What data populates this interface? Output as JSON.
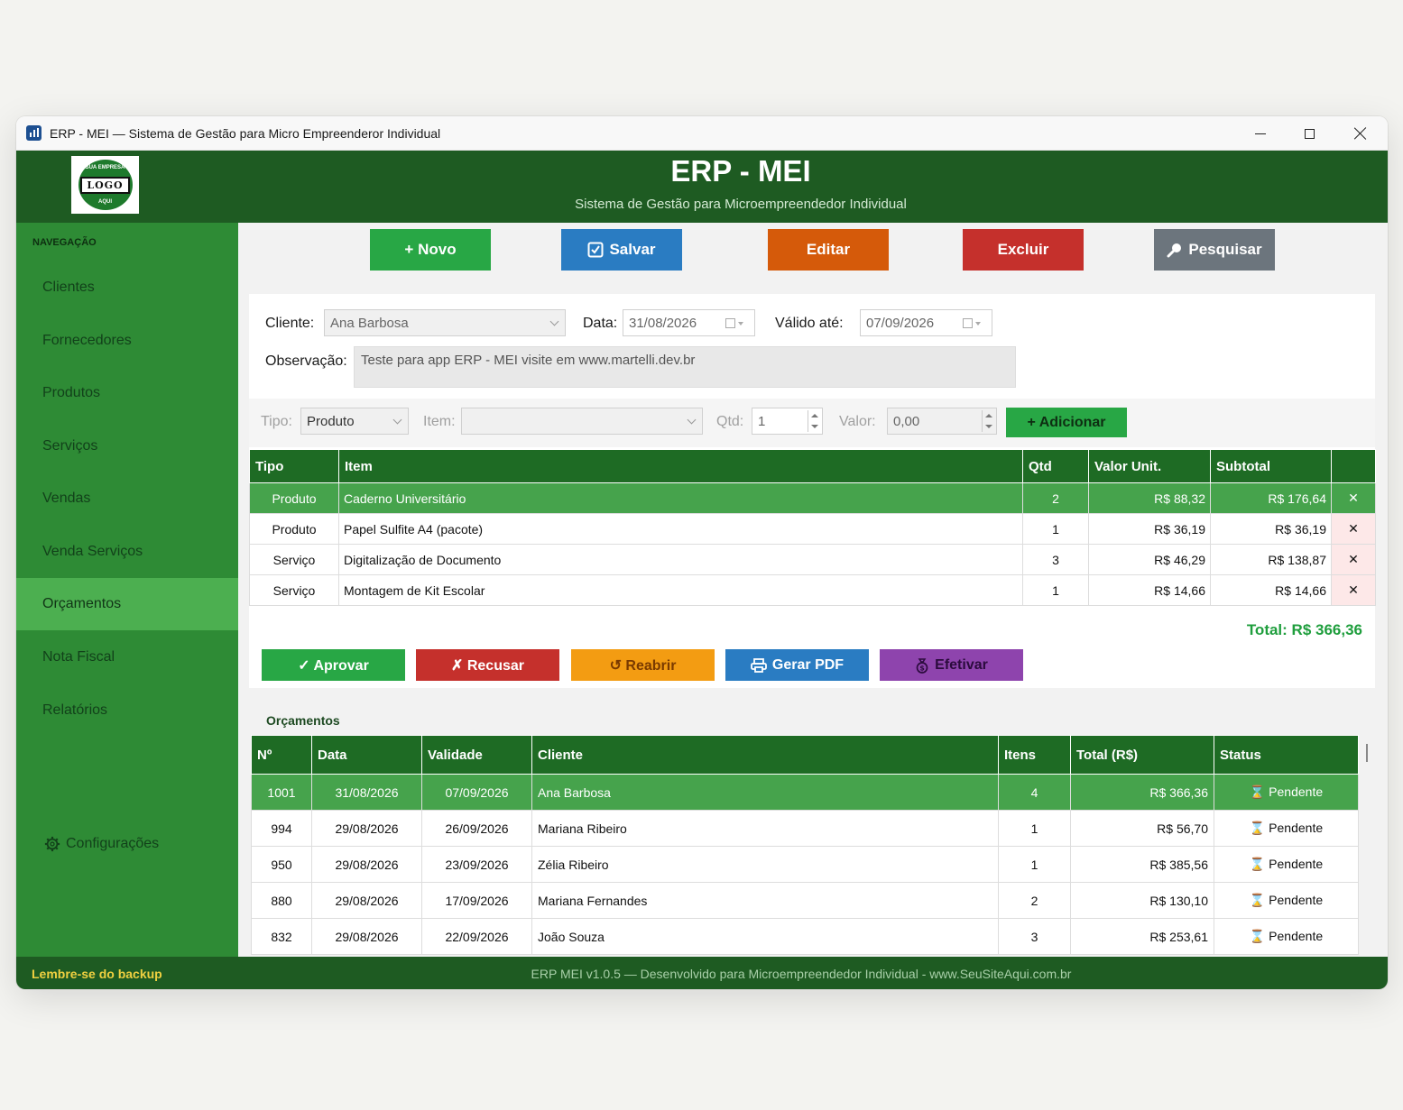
{
  "window": {
    "title": "ERP - MEI — Sistema de Gestão para Micro Empreenderor Individual"
  },
  "header": {
    "logo": {
      "top_text": "SUA EMPRESA",
      "main_text": "LOGO",
      "bottom_text": "AQUI"
    },
    "title": "ERP - MEI",
    "subtitle": "Sistema de Gestão para Microempreendedor Individual"
  },
  "sidebar": {
    "section_label": "NAVEGAÇÃO",
    "items": [
      {
        "label": "Clientes"
      },
      {
        "label": "Fornecedores"
      },
      {
        "label": "Produtos"
      },
      {
        "label": "Serviços"
      },
      {
        "label": "Vendas"
      },
      {
        "label": "Venda Serviços"
      },
      {
        "label": "Orçamentos",
        "active": true
      },
      {
        "label": "Nota Fiscal"
      },
      {
        "label": "Relatórios"
      }
    ],
    "settings_label": "Configurações"
  },
  "toolbar": {
    "novo": "+ Novo",
    "salvar": "Salvar",
    "editar": "Editar",
    "excluir": "Excluir",
    "pesquisar": "Pesquisar"
  },
  "form": {
    "cliente_label": "Cliente:",
    "cliente_value": "Ana Barbosa",
    "data_label": "Data:",
    "data_value": "31/08/2026",
    "valido_label": "Válido até:",
    "valido_value": "07/09/2026",
    "obs_label": "Observação:",
    "obs_value": "Teste para app ERP - MEI visite em www.martelli.dev.br"
  },
  "add_item": {
    "tipo_label": "Tipo:",
    "tipo_value": "Produto",
    "item_label": "Item:",
    "item_value": "",
    "qtd_label": "Qtd:",
    "qtd_value": "1",
    "valor_label": "Valor:",
    "valor_value": "0,00",
    "add_button": "+ Adicionar"
  },
  "items_table": {
    "headers": [
      "Tipo",
      "Item",
      "Qtd",
      "Valor Unit.",
      "Subtotal",
      ""
    ],
    "rows": [
      {
        "tipo": "Produto",
        "item": "Caderno Universitário",
        "qtd": "2",
        "valor": "R$ 88,32",
        "subtotal": "R$ 176,64",
        "del": "✕"
      },
      {
        "tipo": "Produto",
        "item": "Papel Sulfite A4 (pacote)",
        "qtd": "1",
        "valor": "R$ 36,19",
        "subtotal": "R$ 36,19",
        "del": "✕"
      },
      {
        "tipo": "Serviço",
        "item": "Digitalização de Documento",
        "qtd": "3",
        "valor": "R$ 46,29",
        "subtotal": "R$ 138,87",
        "del": "✕"
      },
      {
        "tipo": "Serviço",
        "item": "Montagem de Kit Escolar",
        "qtd": "1",
        "valor": "R$ 14,66",
        "subtotal": "R$ 14,66",
        "del": "✕"
      }
    ]
  },
  "total": "Total: R$ 366,36",
  "actions": {
    "aprovar": "✓ Aprovar",
    "recusar": "✗ Recusar",
    "reabrir": "↺ Reabrir",
    "gerar_pdf": "Gerar PDF",
    "efetivar": "Efetivar"
  },
  "orcamentos": {
    "title": "Orçamentos",
    "headers": [
      "Nº",
      "Data",
      "Validade",
      "Cliente",
      "Itens",
      "Total (R$)",
      "Status"
    ],
    "rows": [
      {
        "num": "1001",
        "data": "31/08/2026",
        "validade": "07/09/2026",
        "cliente": "Ana Barbosa",
        "itens": "4",
        "total": "R$ 366,36",
        "status": "⌛ Pendente"
      },
      {
        "num": "994",
        "data": "29/08/2026",
        "validade": "26/09/2026",
        "cliente": "Mariana Ribeiro",
        "itens": "1",
        "total": "R$ 56,70",
        "status": "⌛ Pendente"
      },
      {
        "num": "950",
        "data": "29/08/2026",
        "validade": "23/09/2026",
        "cliente": "Zélia Ribeiro",
        "itens": "1",
        "total": "R$ 385,56",
        "status": "⌛ Pendente"
      },
      {
        "num": "880",
        "data": "29/08/2026",
        "validade": "17/09/2026",
        "cliente": "Mariana Fernandes",
        "itens": "2",
        "total": "R$ 130,10",
        "status": "⌛ Pendente"
      },
      {
        "num": "832",
        "data": "29/08/2026",
        "validade": "22/09/2026",
        "cliente": "João Souza",
        "itens": "3",
        "total": "R$ 253,61",
        "status": "⌛ Pendente"
      }
    ]
  },
  "footer": {
    "backup": "Lembre-se do backup",
    "info": "ERP MEI v1.0.5  —  Desenvolvido para Microempreendedor Individual  -  www.SeuSiteAqui.com.br"
  },
  "colors": {
    "header_green": "#1e5b22",
    "sidebar_green": "#2e8b35",
    "active_green": "#4caf50",
    "table_header": "#1e6b24",
    "total_green": "#1f9e3d"
  }
}
